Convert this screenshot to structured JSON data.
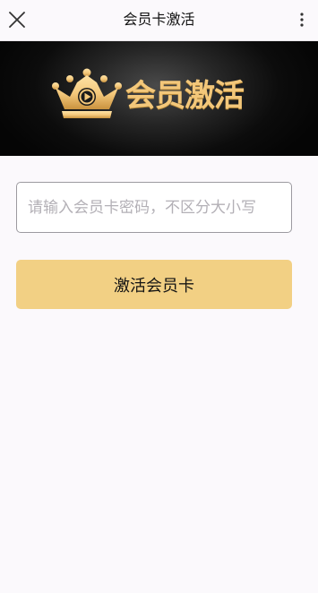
{
  "header": {
    "title": "会员卡激活",
    "close_icon": "close-icon",
    "more_icon": "more-vertical-icon"
  },
  "banner": {
    "logo_icon": "crown-play-icon",
    "title": "会员激活"
  },
  "form": {
    "card_password_placeholder": "请输入会员卡密码，不区分大小写",
    "card_password_value": ""
  },
  "actions": {
    "activate_label": "激活会员卡"
  },
  "colors": {
    "background": "#fbf9fc",
    "banner_dark": "#0c0c0c",
    "gold": "#f3c77a",
    "button": "#f2d084",
    "input_border": "#9c9aa0",
    "placeholder": "#b3b0b6"
  }
}
